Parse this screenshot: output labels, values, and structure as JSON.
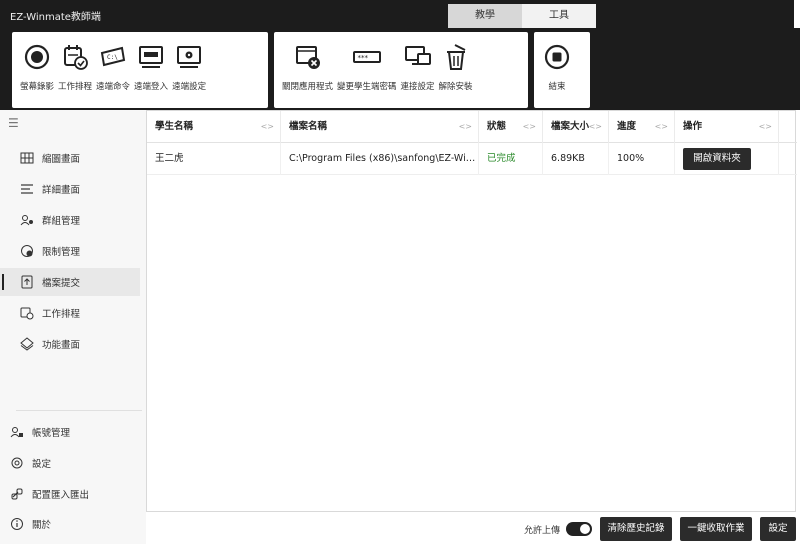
{
  "app": {
    "title": "EZ-Winmate教師端"
  },
  "tabs": [
    {
      "label": "教學",
      "active": true
    },
    {
      "label": "工具",
      "active": false
    }
  ],
  "ribbon": {
    "group1": [
      {
        "label": "螢幕錄影",
        "icon": "record-icon"
      },
      {
        "label": "工作排程",
        "icon": "schedule-icon"
      },
      {
        "label": "遠端命令",
        "icon": "remote-command-icon"
      },
      {
        "label": "遠端登入",
        "icon": "remote-login-icon"
      },
      {
        "label": "遠端設定",
        "icon": "remote-settings-icon"
      }
    ],
    "group2": [
      {
        "label": "關閉應用程式",
        "icon": "close-app-icon"
      },
      {
        "label": "變更學生端密碼",
        "icon": "change-password-icon"
      },
      {
        "label": "連接設定",
        "icon": "connection-settings-icon"
      },
      {
        "label": "解除安裝",
        "icon": "uninstall-icon"
      }
    ],
    "group3": [
      {
        "label": "結束",
        "icon": "stop-icon"
      }
    ]
  },
  "sidebar": {
    "menu_icon": "menu-icon",
    "items": [
      {
        "label": "縮圖畫面",
        "icon": "grid-icon"
      },
      {
        "label": "詳細畫面",
        "icon": "list-detail-icon"
      },
      {
        "label": "群組管理",
        "icon": "group-icon"
      },
      {
        "label": "限制管理",
        "icon": "restrict-icon"
      },
      {
        "label": "檔案提交",
        "icon": "file-submit-icon",
        "active": true
      },
      {
        "label": "工作排程",
        "icon": "schedule-icon"
      },
      {
        "label": "功能畫面",
        "icon": "feature-icon"
      }
    ],
    "bottom_items": [
      {
        "label": "帳號管理",
        "icon": "account-icon"
      },
      {
        "label": "設定",
        "icon": "gear-icon"
      },
      {
        "label": "配置匯入匯出",
        "icon": "import-export-icon"
      },
      {
        "label": "關於",
        "icon": "info-icon"
      }
    ]
  },
  "table": {
    "columns": [
      "學生名稱",
      "檔案名稱",
      "狀態",
      "檔案大小",
      "進度",
      "操作"
    ],
    "sort_glyph": "<>",
    "rows": [
      {
        "student": "王二虎",
        "file": "C:\\Program Files (x86)\\sanfong\\EZ-Win...",
        "status": "已完成",
        "size": "6.89KB",
        "progress": "100%",
        "action": "開啟資料夾"
      }
    ]
  },
  "bottom": {
    "allow_upload_label": "允許上傳",
    "allow_upload_on": true,
    "clear_history": "清除歷史記錄",
    "collect_all": "一鍵收取作業",
    "settings": "設定"
  },
  "colors": {
    "dark": "#1c1c1c",
    "status_done": "#2a8a2a",
    "button_bg": "#2b2b2b"
  }
}
